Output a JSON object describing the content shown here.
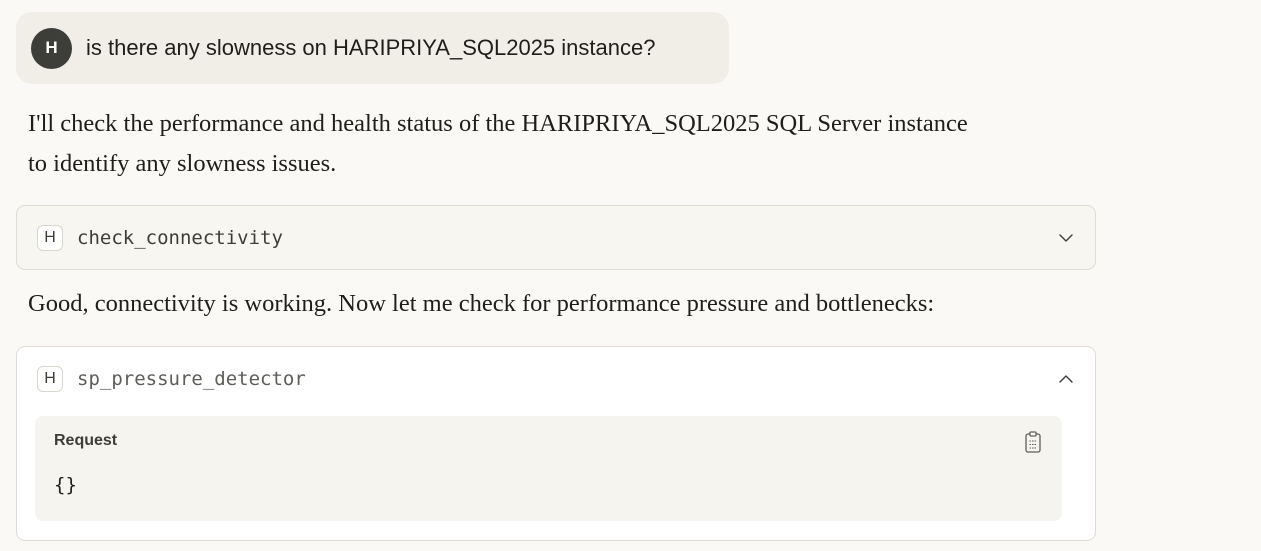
{
  "user_message": {
    "avatar_initial": "H",
    "text": "is there any slowness on HARIPRIYA_SQL2025 instance?"
  },
  "assistant": {
    "intro_line1": "I'll check the performance and health status of the HARIPRIYA_SQL2025 SQL Server instance",
    "intro_line2": "to identify any slowness issues.",
    "followup": "Good, connectivity is working. Now let me check for performance pressure and bottlenecks:"
  },
  "tool_calls": [
    {
      "badge": "H",
      "name": "check_connectivity",
      "expanded": false,
      "icon": "chevron-down-icon"
    },
    {
      "badge": "H",
      "name": "sp_pressure_detector",
      "expanded": true,
      "icon": "chevron-up-icon",
      "request_label": "Request",
      "request_body": "{}",
      "copy_icon": "clipboard-icon"
    }
  ],
  "colors": {
    "background": "#faf9f5",
    "user_bubble": "#f0eee6",
    "avatar": "#3d3d3a",
    "card_border": "#dedcd3"
  }
}
